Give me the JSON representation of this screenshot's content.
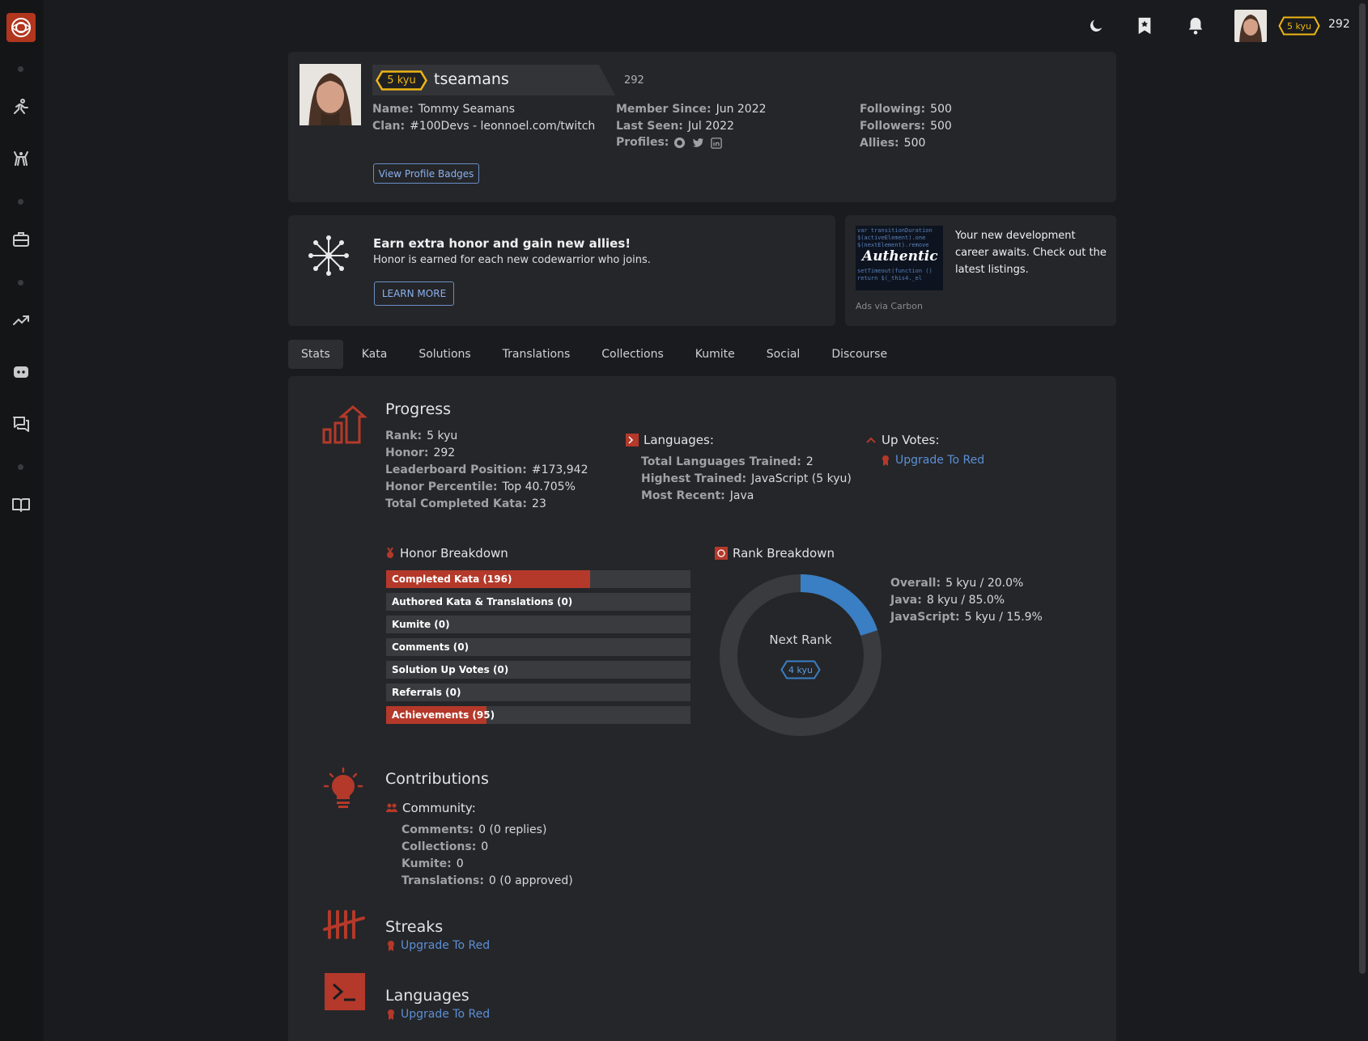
{
  "colors": {
    "accent": "#b4392a",
    "link": "#5b8fd6",
    "kyu": "#ecb613",
    "progress_arc": "#3a7ec4"
  },
  "topbar": {
    "rank": "5 kyu",
    "honor": "292"
  },
  "profile": {
    "rank": "5 kyu",
    "username": "tseamans",
    "honor": "292",
    "name_label": "Name:",
    "name": "Tommy Seamans",
    "clan_label": "Clan:",
    "clan": "#100Devs - leonnoel.com/twitch",
    "member_since_label": "Member Since:",
    "member_since": "Jun 2022",
    "last_seen_label": "Last Seen:",
    "last_seen": "Jul 2022",
    "profiles_label": "Profiles:",
    "following_label": "Following:",
    "following": "500",
    "followers_label": "Followers:",
    "followers": "500",
    "allies_label": "Allies:",
    "allies": "500",
    "badges_button": "View Profile Badges"
  },
  "promo": {
    "title": "Earn extra honor and gain new allies!",
    "text": "Honor is earned for each new codewarrior who joins.",
    "button": "LEARN MORE"
  },
  "ad": {
    "text": "Your new development career awaits. Check out the latest listings.",
    "via": "Ads via Carbon",
    "image_text": "Authentic"
  },
  "tabs": [
    "Stats",
    "Kata",
    "Solutions",
    "Translations",
    "Collections",
    "Kumite",
    "Social",
    "Discourse"
  ],
  "progress": {
    "title": "Progress",
    "rank_label": "Rank:",
    "rank": "5 kyu",
    "honor_label": "Honor:",
    "honor": "292",
    "leaderboard_label": "Leaderboard Position:",
    "leaderboard": "#173,942",
    "percentile_label": "Honor Percentile:",
    "percentile": "Top 40.705%",
    "completed_label": "Total Completed Kata:",
    "completed": "23"
  },
  "languages_summary": {
    "title": "Languages:",
    "total_label": "Total Languages Trained:",
    "total": "2",
    "highest_label": "Highest Trained:",
    "highest": "JavaScript (5 kyu)",
    "recent_label": "Most Recent:",
    "recent": "Java"
  },
  "upvotes": {
    "title": "Up Votes:",
    "link": "Upgrade To Red"
  },
  "honor_breakdown": {
    "title": "Honor Breakdown",
    "bars": [
      {
        "label": "Completed Kata (196)",
        "fraction": 0.67
      },
      {
        "label": "Authored Kata & Translations (0)",
        "fraction": 0
      },
      {
        "label": "Kumite (0)",
        "fraction": 0
      },
      {
        "label": "Comments (0)",
        "fraction": 0
      },
      {
        "label": "Solution Up Votes (0)",
        "fraction": 0
      },
      {
        "label": "Referrals (0)",
        "fraction": 0
      },
      {
        "label": "Achievements (95)",
        "fraction": 0.33
      }
    ]
  },
  "rank_breakdown": {
    "title": "Rank Breakdown",
    "center_label": "Next Rank",
    "next_rank": "4 kyu",
    "progress_fraction": 0.2,
    "overall_label": "Overall:",
    "overall": "5 kyu / 20.0%",
    "java_label": "Java:",
    "java": "8 kyu / 85.0%",
    "js_label": "JavaScript:",
    "js": "5 kyu / 15.9%"
  },
  "contributions": {
    "title": "Contributions",
    "community": "Community:",
    "comments_label": "Comments:",
    "comments": "0 (0 replies)",
    "collections_label": "Collections:",
    "collections": "0",
    "kumite_label": "Kumite:",
    "kumite": "0",
    "translations_label": "Translations:",
    "translations": "0 (0 approved)"
  },
  "streaks": {
    "title": "Streaks",
    "link": "Upgrade To Red"
  },
  "languages": {
    "title": "Languages",
    "link": "Upgrade To Red"
  }
}
